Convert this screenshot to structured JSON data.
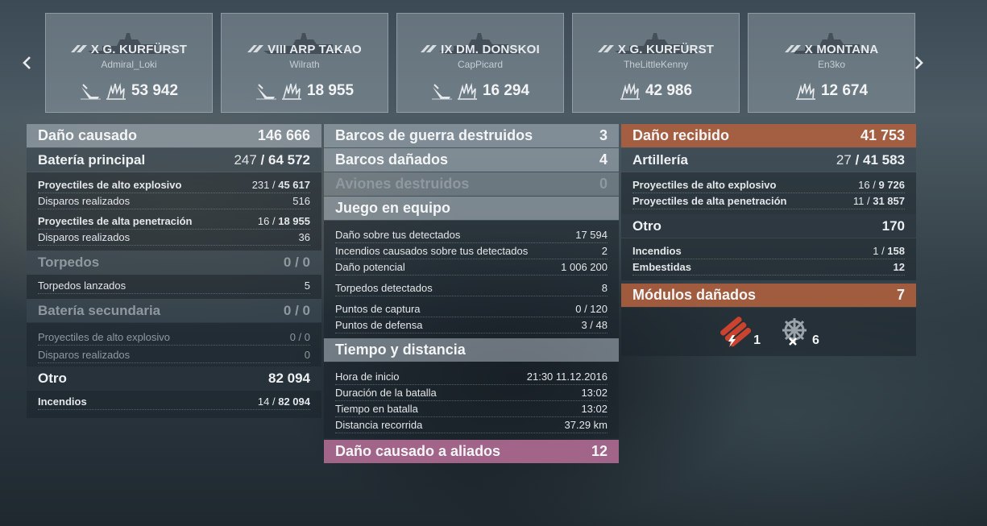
{
  "nav": {
    "prev": "‹",
    "next": "›"
  },
  "cards": [
    {
      "tier": "X",
      "ship": "G. KURFÜRST",
      "player": "Admiral_Loki",
      "has_kills": true,
      "damage": "53 942"
    },
    {
      "tier": "VIII",
      "ship": "ARP TAKAO",
      "player": "Wilrath",
      "has_kills": true,
      "damage": "18 955"
    },
    {
      "tier": "IX",
      "ship": "DM. DONSKOI",
      "player": "CapPicard",
      "has_kills": true,
      "damage": "16 294"
    },
    {
      "tier": "X",
      "ship": "G. KURFÜRST",
      "player": "TheLittleKenny",
      "has_kills": false,
      "damage": "42 986"
    },
    {
      "tier": "X",
      "ship": "MONTANA",
      "player": "En3ko",
      "has_kills": false,
      "damage": "12 674"
    }
  ],
  "left": {
    "damage": {
      "label": "Daño causado",
      "value": "146 666"
    },
    "main_battery": {
      "label": "Batería principal",
      "hits": "247",
      "dmg": "64 572",
      "he": {
        "label": "Proyectiles de alto explosivo",
        "hits": "231",
        "dmg": "45 617"
      },
      "he_shots": {
        "label": "Disparos realizados",
        "value": "516"
      },
      "ap": {
        "label": "Proyectiles de alta penetración",
        "hits": "16",
        "dmg": "18 955"
      },
      "ap_shots": {
        "label": "Disparos realizados",
        "value": "36"
      }
    },
    "torpedoes": {
      "label": "Torpedos",
      "hits": "0",
      "dmg": "0",
      "launched": {
        "label": "Torpedos lanzados",
        "value": "5"
      }
    },
    "secondary": {
      "label": "Batería secundaria",
      "hits": "0",
      "dmg": "0",
      "he": {
        "label": "Proyectiles de alto explosivo",
        "hits": "0",
        "dmg": "0"
      },
      "shots": {
        "label": "Disparos realizados",
        "value": "0"
      }
    },
    "other": {
      "label": "Otro",
      "value": "82 094",
      "fires": {
        "label": "Incendios",
        "hits": "14",
        "dmg": "82 094"
      }
    }
  },
  "middle": {
    "destroyed": {
      "label": "Barcos de guerra destruidos",
      "value": "3"
    },
    "damaged": {
      "label": "Barcos dañados",
      "value": "4"
    },
    "planes": {
      "label": "Aviones destruidos",
      "value": "0"
    },
    "team": {
      "label": "Juego en equipo",
      "rows": [
        {
          "label": "Daño sobre tus detectados",
          "value": "17 594"
        },
        {
          "label": "Incendios causados sobre tus detectados",
          "value": "2"
        },
        {
          "label": "Daño potencial",
          "value": "1 006 200"
        },
        {
          "label": "Torpedos detectados",
          "value": "8"
        },
        {
          "label": "Puntos de captura",
          "value": "0 / 120"
        },
        {
          "label": "Puntos de defensa",
          "value": "3 / 48"
        }
      ]
    },
    "time": {
      "label": "Tiempo y distancia",
      "rows": [
        {
          "label": "Hora de inicio",
          "value": "21:30  11.12.2016"
        },
        {
          "label": "Duración de la batalla",
          "value": "13:02"
        },
        {
          "label": "Tiempo en batalla",
          "value": "13:02"
        },
        {
          "label": "Distancia recorrida",
          "value": "37.29 km"
        }
      ]
    },
    "allies": {
      "label": "Daño causado a aliados",
      "value": "12"
    }
  },
  "right": {
    "received": {
      "label": "Daño recibido",
      "value": "41 753"
    },
    "artillery": {
      "label": "Artillería",
      "hits": "27",
      "dmg": "41 583",
      "he": {
        "label": "Proyectiles de alto explosivo",
        "hits": "16",
        "dmg": "9 726"
      },
      "ap": {
        "label": "Proyectiles de alta penetración",
        "hits": "11",
        "dmg": "31 857"
      }
    },
    "other": {
      "label": "Otro",
      "value": "170",
      "fires": {
        "label": "Incendios",
        "hits": "1",
        "dmg": "158"
      },
      "ram": {
        "label": "Embestidas",
        "value": "12"
      }
    },
    "modules": {
      "label": "Módulos dañados",
      "value": "7",
      "items": [
        {
          "icon": "torpedo-tubes-icon",
          "count": "1"
        },
        {
          "icon": "steering-icon",
          "count": "6"
        }
      ]
    }
  },
  "colors": {
    "received_header": "#b0603e",
    "allies_header": "#b06c94"
  }
}
